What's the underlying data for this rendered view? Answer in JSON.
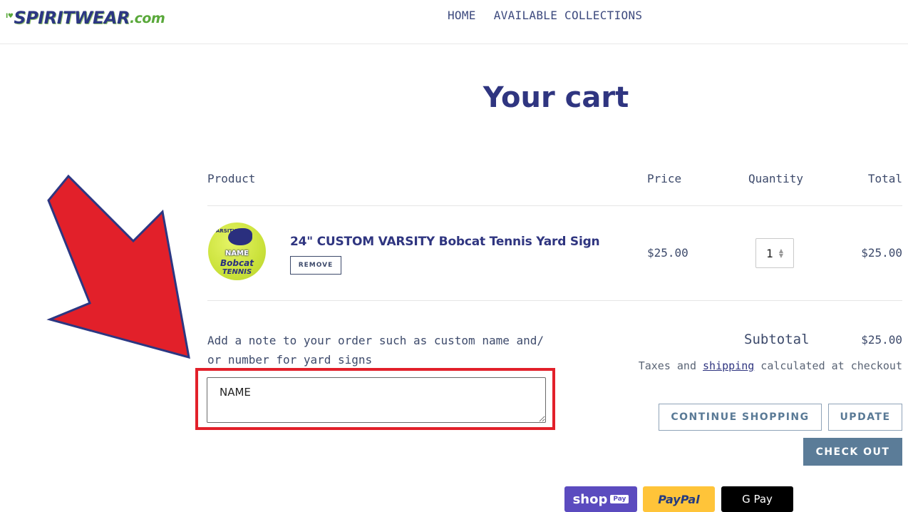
{
  "header": {
    "logo": {
      "prefix": "I♥",
      "main": "SPIRITWEAR",
      "suffix": ".com"
    },
    "nav": [
      "HOME",
      "AVAILABLE COLLECTIONS"
    ]
  },
  "page_title": "Your cart",
  "table": {
    "headers": {
      "product": "Product",
      "price": "Price",
      "quantity": "Quantity",
      "total": "Total"
    },
    "items": [
      {
        "name": "24\" CUSTOM VARSITY Bobcat Tennis Yard Sign",
        "thumb_text": {
          "top": "VARSITY",
          "name": "NAME",
          "team": "Bobcat",
          "sport": "TENNIS"
        },
        "remove_label": "REMOVE",
        "price": "$25.00",
        "quantity": "1",
        "total": "$25.00"
      }
    ]
  },
  "note": {
    "label": "Add a note to your order such as custom name and/ or number for yard signs",
    "value": "NAME"
  },
  "summary": {
    "subtotal_label": "Subtotal",
    "subtotal_value": "$25.00",
    "tax_before": "Taxes and ",
    "tax_link": "shipping",
    "tax_after": " calculated at checkout"
  },
  "buttons": {
    "continue": "CONTINUE SHOPPING",
    "update": "UPDATE",
    "checkout": "CHECK OUT"
  },
  "payments": {
    "shop_pay": "shop",
    "shop_pay_badge": "Pay",
    "paypal": "PayPal",
    "gpay": "G Pay"
  },
  "annotation": {
    "arrow_color": "#e2202a",
    "arrow_outline": "#2c3782",
    "highlight_color": "#e2202a"
  }
}
